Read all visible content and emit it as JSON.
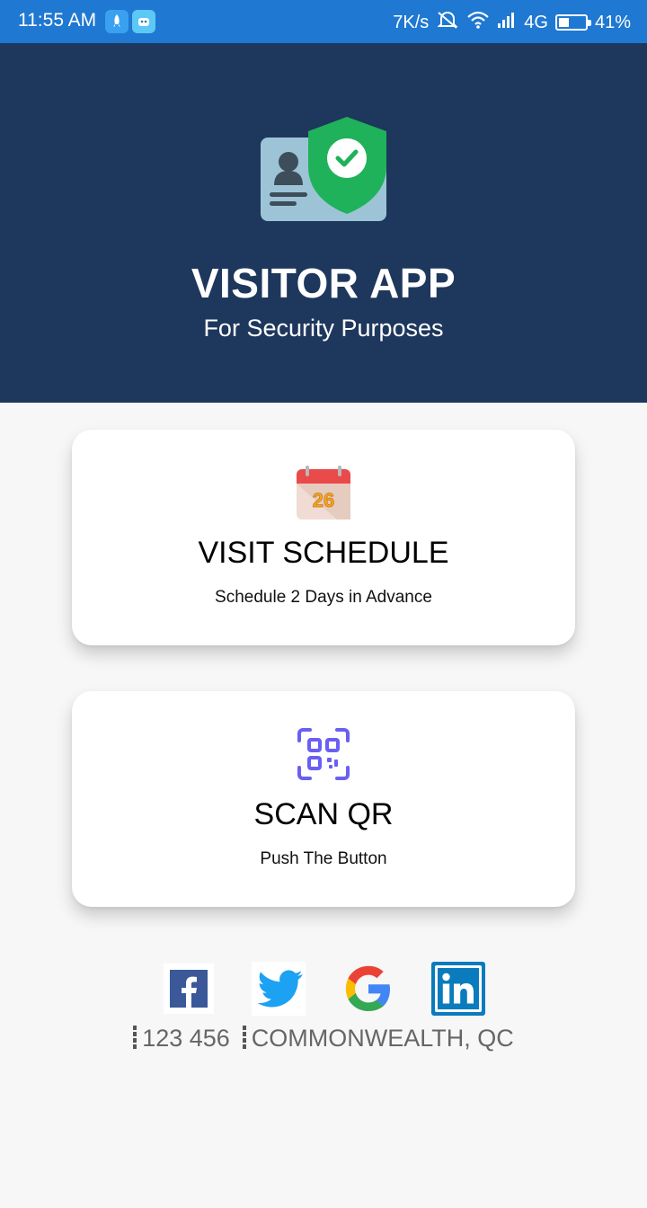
{
  "status_bar": {
    "time": "11:55 AM",
    "speed": "7K/s",
    "network": "4G",
    "battery": "41%",
    "battery_level": 0.41,
    "icons": [
      "rocket-app-icon",
      "robot-app-icon",
      "mute-icon",
      "wifi-icon",
      "signal-icon",
      "battery-icon"
    ]
  },
  "header": {
    "title": "VISITOR APP",
    "subtitle": "For Security Purposes",
    "logo_icon": "id-card-shield-icon",
    "background_color": "#1e375c"
  },
  "cards": {
    "schedule": {
      "icon": "calendar-icon",
      "icon_text": "26",
      "title": "VISIT SCHEDULE",
      "subtitle": "Schedule 2 Days in Advance"
    },
    "scan": {
      "icon": "qr-code-icon",
      "title": "SCAN QR",
      "subtitle": "Push The Button"
    }
  },
  "social": [
    "facebook-icon",
    "twitter-icon",
    "google-icon",
    "linkedin-icon"
  ],
  "footer": {
    "phone": "123 456",
    "location": "COMMONWEALTH, QC"
  }
}
